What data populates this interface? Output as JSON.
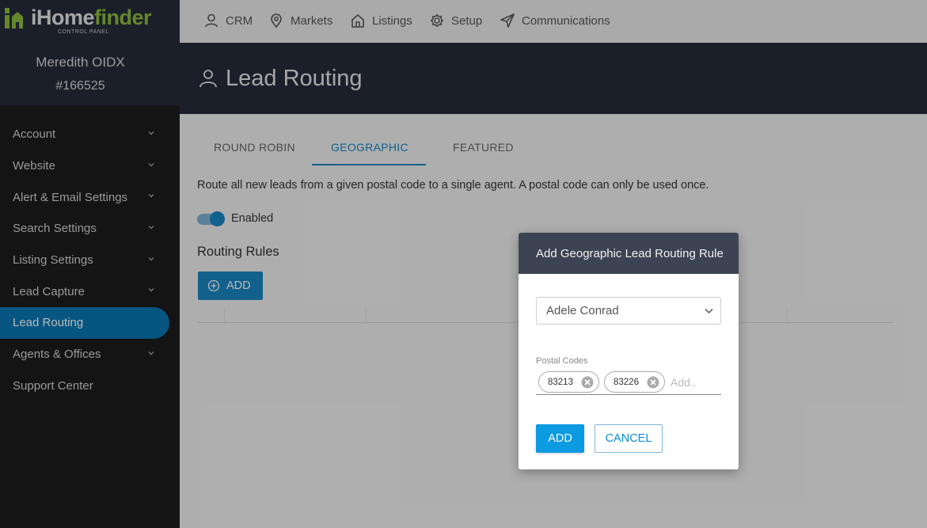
{
  "brand": {
    "logo_i": "i",
    "logo_home": "Home",
    "logo_finder": "finder",
    "logo_sub": "CONTROL PANEL",
    "accent_color": "#8dbb3e"
  },
  "user": {
    "name": "Meredith OIDX",
    "id": "#166525"
  },
  "sidebar": {
    "items": [
      {
        "label": "Account",
        "has_chevron": true
      },
      {
        "label": "Website",
        "has_chevron": true
      },
      {
        "label": "Alert & Email Settings",
        "has_chevron": true
      },
      {
        "label": "Search Settings",
        "has_chevron": true
      },
      {
        "label": "Listing Settings",
        "has_chevron": true
      },
      {
        "label": "Lead Capture",
        "has_chevron": true
      },
      {
        "label": "Lead Routing",
        "has_chevron": false,
        "active": true
      },
      {
        "label": "Agents & Offices",
        "has_chevron": true
      },
      {
        "label": "Support Center",
        "has_chevron": false
      }
    ],
    "active_color": "#0b77b3"
  },
  "topnav": {
    "crm": "CRM",
    "markets": "Markets",
    "listings": "Listings",
    "setup": "Setup",
    "communications": "Communications"
  },
  "page": {
    "title": "Lead Routing"
  },
  "tabs": {
    "round_robin": "ROUND ROBIN",
    "geographic": "GEOGRAPHIC",
    "featured": "FEATURED",
    "active": "GEOGRAPHIC"
  },
  "content": {
    "description": "Route all new leads from a given postal code to a single agent. A postal code can only be used once.",
    "toggle_label": "Enabled",
    "toggle_on": true,
    "rules_title": "Routing Rules",
    "add_label": "ADD"
  },
  "modal": {
    "title": "Add Geographic Lead Routing Rule",
    "agent_selected": "Adele Conrad",
    "postal_label": "Postal Codes",
    "postal_codes": [
      "83213",
      "83226"
    ],
    "postal_placeholder": "Add..",
    "add_label": "ADD",
    "cancel_label": "CANCEL",
    "primary_color": "#0c9ae0"
  }
}
